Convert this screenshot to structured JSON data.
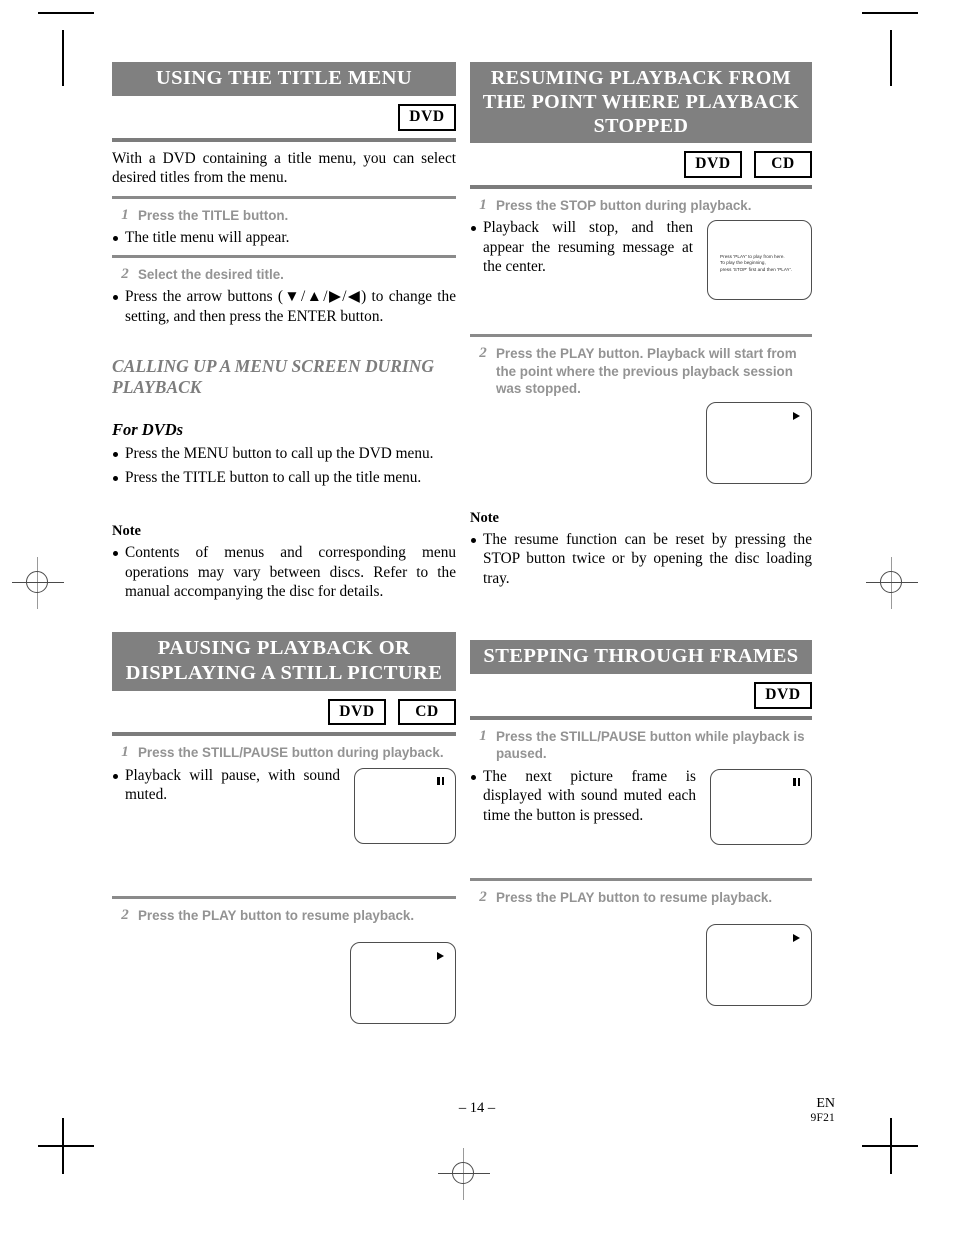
{
  "document": {
    "page_number": "– 14 –",
    "language_code": "EN",
    "doc_code": "9F21"
  },
  "left_column": {
    "section1": {
      "heading": "USING THE TITLE MENU",
      "badges": [
        "DVD"
      ],
      "intro": "With a DVD containing a title menu, you can select desired titles from the menu.",
      "steps": [
        {
          "num": "1",
          "text": "Press the TITLE button.",
          "bullets": [
            "The title menu will appear."
          ]
        },
        {
          "num": "2",
          "text": "Select the desired title.",
          "bullets": [
            "Press the arrow buttons (▼/▲/▶/◀) to change the setting, and then press the ENTER button."
          ]
        }
      ]
    },
    "subsection": {
      "heading": "CALLING UP A MENU SCREEN DURING PLAYBACK",
      "sub_heading": "For DVDs",
      "bullets": [
        "Press the MENU button to call up the DVD menu.",
        "Press the TITLE button to call up the title menu."
      ],
      "note_label": "Note",
      "note_bullets": [
        "Contents of menus and corresponding menu operations may vary between discs. Refer to the manual accompanying the disc for details."
      ]
    },
    "section2": {
      "heading": "PAUSING PLAYBACK OR DISPLAYING A STILL PICTURE",
      "badges": [
        "DVD",
        "CD"
      ],
      "steps": [
        {
          "num": "1",
          "text": "Press the STILL/PAUSE button during playback.",
          "bullets": [
            "Playback will pause, with sound muted."
          ],
          "tv_icon": "pause-icon"
        },
        {
          "num": "2",
          "text": "Press the PLAY button to resume playback.",
          "bullets": [],
          "tv_icon": "play-icon"
        }
      ]
    }
  },
  "right_column": {
    "section1": {
      "heading": "RESUMING PLAYBACK FROM THE POINT WHERE PLAYBACK STOPPED",
      "badges": [
        "DVD",
        "CD"
      ],
      "steps": [
        {
          "num": "1",
          "text": "Press the STOP button during playback.",
          "bullets": [
            "Playback will stop, and then appear the resuming message at the center."
          ],
          "tv_osd": "Press 'PLAY' to play from here.\nTo play the beginning,\npress 'STOP' first and then 'PLAY'."
        },
        {
          "num": "2",
          "text": "Press the PLAY button. Playback will start from the point where the previous playback session was stopped.",
          "bullets": [],
          "tv_icon": "play-icon"
        }
      ],
      "note_label": "Note",
      "note_bullets": [
        "The resume function can be reset by pressing the STOP button twice or by opening the disc loading tray."
      ]
    },
    "section2": {
      "heading": "STEPPING THROUGH FRAMES",
      "badges": [
        "DVD"
      ],
      "steps": [
        {
          "num": "1",
          "text": "Press the STILL/PAUSE button while playback is paused.",
          "bullets": [
            "The next picture frame is displayed with sound muted each time the button is pressed."
          ],
          "tv_icon": "pause-icon"
        },
        {
          "num": "2",
          "text": "Press the PLAY button to resume playback.",
          "bullets": [],
          "tv_icon": "play-icon"
        }
      ]
    }
  }
}
